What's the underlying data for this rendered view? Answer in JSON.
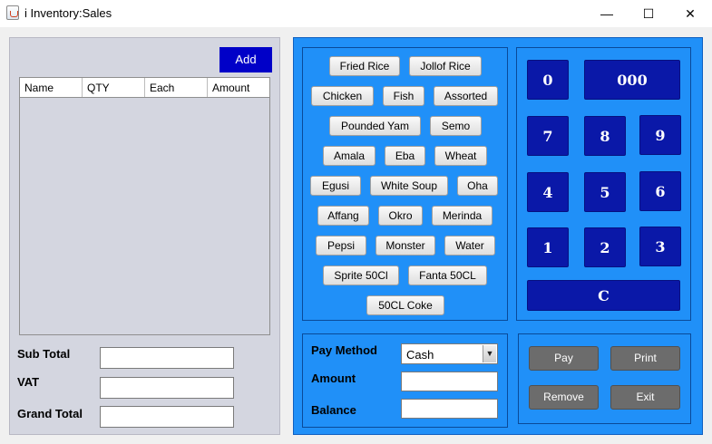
{
  "window": {
    "title": "i Inventory:Sales",
    "minimize": "—",
    "maximize": "☐",
    "close": "✕"
  },
  "left": {
    "add_label": "Add",
    "columns": [
      "Name",
      "QTY",
      "Each",
      "Amount"
    ],
    "sub_total_label": "Sub Total",
    "vat_label": "VAT",
    "grand_total_label": "Grand Total",
    "sub_total_value": "",
    "vat_value": "",
    "grand_total_value": ""
  },
  "menu_items": [
    "Fried Rice",
    "Jollof Rice",
    "Chicken",
    "Fish",
    "Assorted",
    "Pounded Yam",
    "Semo",
    "Amala",
    "Eba",
    "Wheat",
    "Egusi",
    "White Soup",
    "Oha",
    "Affang",
    "Okro",
    "Merinda",
    "Pepsi",
    "Monster",
    "Water",
    "Sprite 50Cl",
    "Fanta 50CL",
    "50CL Coke"
  ],
  "keypad": {
    "zero": "0",
    "triple_zero": "000",
    "seven": "7",
    "eight": "8",
    "nine": "9",
    "four": "4",
    "five": "5",
    "six": "6",
    "one": "1",
    "two": "2",
    "three": "3",
    "clear": "C"
  },
  "payment": {
    "method_label": "Pay Method",
    "method_value": "Cash",
    "amount_label": "Amount",
    "balance_label": "Balance",
    "amount_value": "",
    "balance_value": ""
  },
  "actions": {
    "pay": "Pay",
    "print": "Print",
    "remove": "Remove",
    "exit": "Exit"
  },
  "colors": {
    "right_panel": "#2090f8",
    "keypad_button": "#0a18a8",
    "add_button": "#0000c8",
    "action_button": "#6c6c6c",
    "left_panel": "#d4d6e0"
  }
}
